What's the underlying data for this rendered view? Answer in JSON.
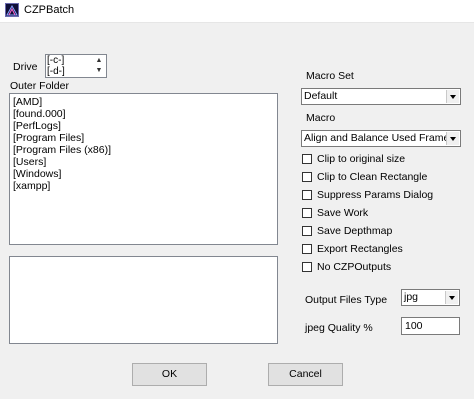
{
  "window": {
    "title": "CZPBatch",
    "icon": "app-icon"
  },
  "drive": {
    "label": "Drive",
    "options": [
      "[-c-]",
      "[-d-]"
    ]
  },
  "outer_folder": {
    "label": "Outer Folder",
    "items": [
      "[AMD]",
      "[found.000]",
      "[PerfLogs]",
      "[Program Files]",
      "[Program Files (x86)]",
      "[Users]",
      "[Windows]",
      "[xampp]"
    ]
  },
  "macro_set": {
    "label": "Macro Set",
    "value": "Default"
  },
  "macro": {
    "label": "Macro",
    "value": "Align and Balance Used Frames"
  },
  "options": [
    {
      "label": "Clip to original size",
      "checked": false
    },
    {
      "label": "Clip to Clean Rectangle",
      "checked": false
    },
    {
      "label": "Suppress Params Dialog",
      "checked": false
    },
    {
      "label": "Save Work",
      "checked": false
    },
    {
      "label": "Save Depthmap",
      "checked": false
    },
    {
      "label": "Export Rectangles",
      "checked": false
    },
    {
      "label": "No CZPOutputs",
      "checked": false
    }
  ],
  "output_files_type": {
    "label": "Output Files Type",
    "value": "jpg"
  },
  "jpeg_quality": {
    "label": "jpeg Quality %",
    "value": "100"
  },
  "buttons": {
    "ok": "OK",
    "cancel": "Cancel"
  }
}
